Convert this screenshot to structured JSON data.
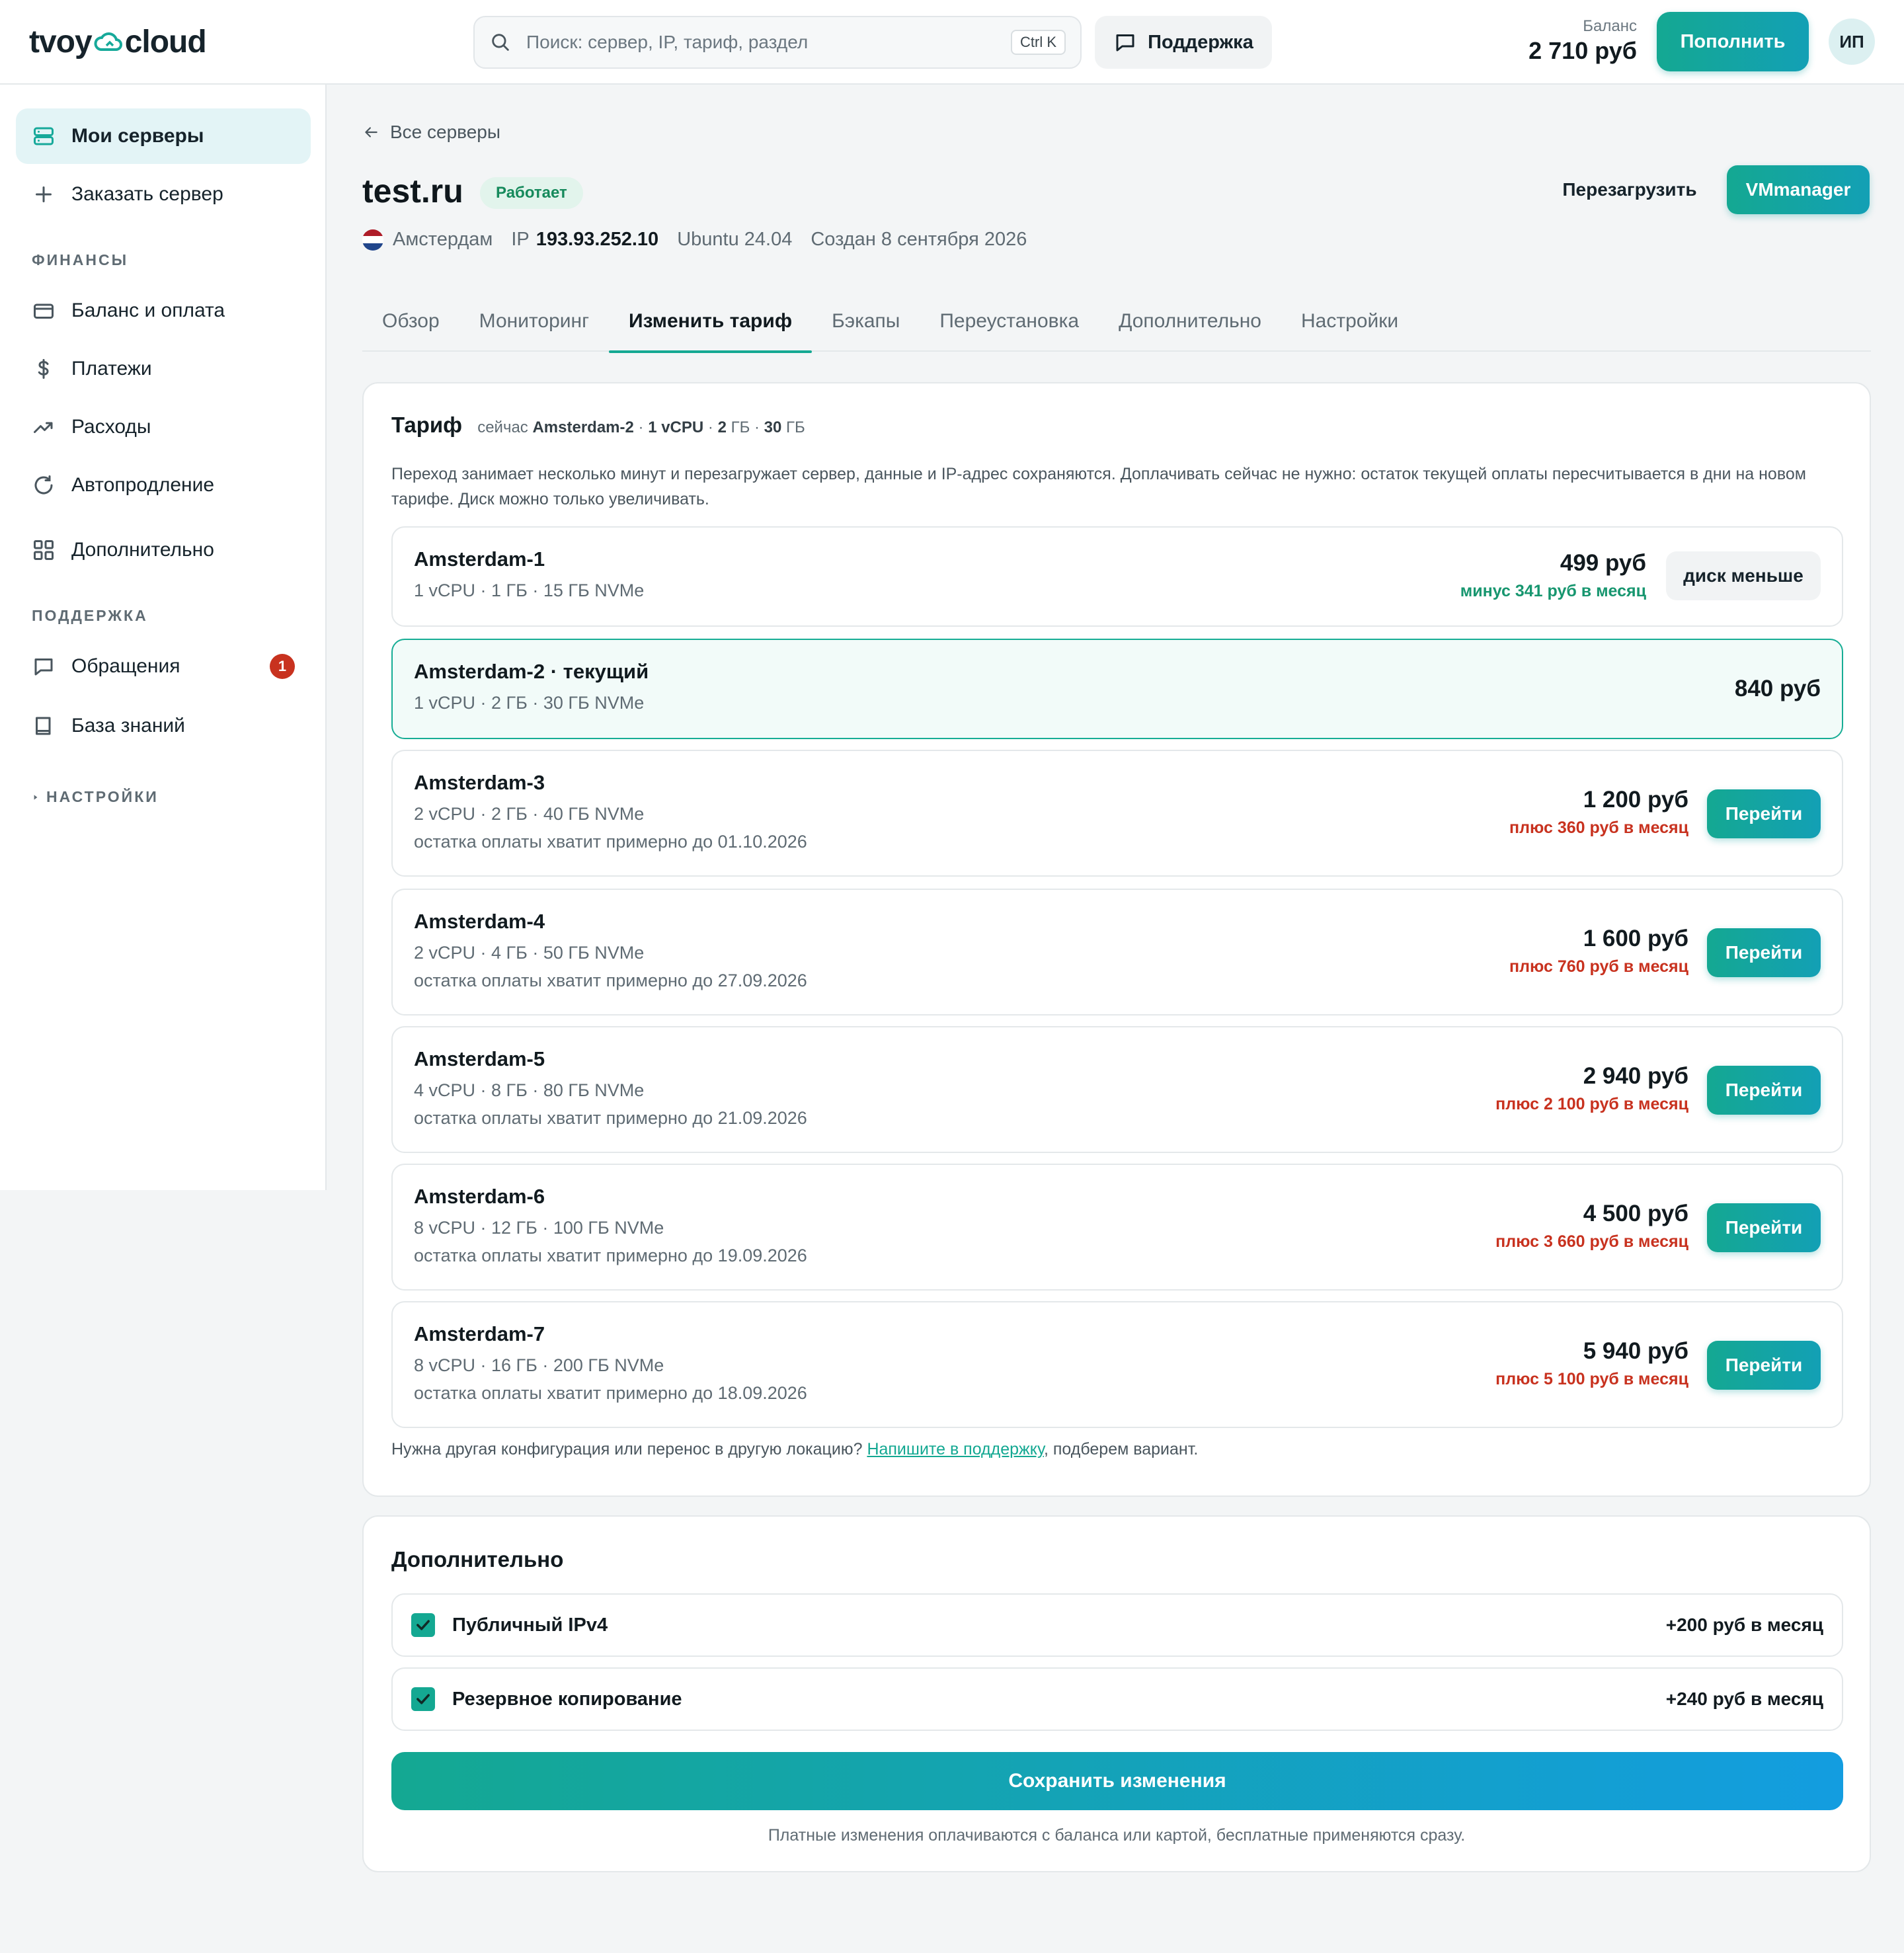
{
  "header": {
    "logo_left": "tvoy",
    "logo_right": "cloud",
    "search_placeholder": "Поиск: сервер, IP, тариф, раздел",
    "search_kbd": "Ctrl K",
    "support": "Поддержка",
    "balance_label": "Баланс",
    "balance_value": "2 710 руб",
    "topup": "Пополнить",
    "avatar": "ИП"
  },
  "sidebar": {
    "my_servers": "Мои серверы",
    "order_server": "Заказать сервер",
    "finance_section": "ФИНАНСЫ",
    "balance_pay": "Баланс и оплата",
    "payments": "Платежи",
    "expenses": "Расходы",
    "autorenew": "Автопродление",
    "extra": "Дополнительно",
    "support_section": "ПОДДЕРЖКА",
    "tickets": "Обращения",
    "tickets_badge": "1",
    "knowledge": "База знаний",
    "settings_section": "НАСТРОЙКИ"
  },
  "server": {
    "back": "Все серверы",
    "name": "test.ru",
    "status": "Работает",
    "reboot": "Перезагрузить",
    "vmmanager": "VMmanager",
    "location": "Амстердам",
    "ip_label": "IP",
    "ip": "193.93.252.10",
    "os": "Ubuntu 24.04",
    "created": "Создан 8 сентября 2026"
  },
  "tabs": [
    "Обзор",
    "Мониторинг",
    "Изменить тариф",
    "Бэкапы",
    "Переустановка",
    "Дополнительно",
    "Настройки"
  ],
  "tariff": {
    "title": "Тариф",
    "now_prefix": "сейчас",
    "now_plan": "Amsterdam-2",
    "now_cpu": "1 vCPU",
    "now_ram_num": "2",
    "now_ram_unit": "ГБ",
    "now_disk_num": "30",
    "now_disk_unit": "ГБ",
    "description": "Переход занимает несколько минут и перезагружает сервер, данные и IP-адрес сохраняются. Доплачивать сейчас не нужно: остаток текущей оплаты пересчитывается в дни на новом тарифе. Диск можно только увеличивать.",
    "plans": [
      {
        "name": "Amsterdam-1",
        "spec": "1 vCPU · 1 ГБ · 15 ГБ NVMe",
        "price": "499 руб",
        "diff": "минус 341 руб в месяц",
        "action": "диск меньше"
      },
      {
        "name": "Amsterdam-2 · текущий",
        "spec": "1 vCPU · 2 ГБ · 30 ГБ NVMe",
        "price": "840 руб"
      },
      {
        "name": "Amsterdam-3",
        "spec": "2 vCPU · 2 ГБ · 40 ГБ NVMe",
        "note": "остатка оплаты хватит примерно до 01.10.2026",
        "price": "1 200 руб",
        "diff": "плюс 360 руб в месяц",
        "action": "Перейти"
      },
      {
        "name": "Amsterdam-4",
        "spec": "2 vCPU · 4 ГБ · 50 ГБ NVMe",
        "note": "остатка оплаты хватит примерно до 27.09.2026",
        "price": "1 600 руб",
        "diff": "плюс 760 руб в месяц",
        "action": "Перейти"
      },
      {
        "name": "Amsterdam-5",
        "spec": "4 vCPU · 8 ГБ · 80 ГБ NVMe",
        "note": "остатка оплаты хватит примерно до 21.09.2026",
        "price": "2 940 руб",
        "diff": "плюс 2 100 руб в месяц",
        "action": "Перейти"
      },
      {
        "name": "Amsterdam-6",
        "spec": "8 vCPU · 12 ГБ · 100 ГБ NVMe",
        "note": "остатка оплаты хватит примерно до 19.09.2026",
        "price": "4 500 руб",
        "diff": "плюс 3 660 руб в месяц",
        "action": "Перейти"
      },
      {
        "name": "Amsterdam-7",
        "spec": "8 vCPU · 16 ГБ · 200 ГБ NVMe",
        "note": "остатка оплаты хватит примерно до 18.09.2026",
        "price": "5 940 руб",
        "diff": "плюс 5 100 руб в месяц",
        "action": "Перейти"
      }
    ],
    "footer_text": "Нужна другая конфигурация или перенос в другую локацию?",
    "footer_link": "Напишите в поддержку",
    "footer_tail": ", подберем вариант."
  },
  "extras": {
    "title": "Дополнительно",
    "options": [
      {
        "label": "Публичный IPv4",
        "price": "+200 руб в месяц",
        "checked": true
      },
      {
        "label": "Резервное копирование",
        "price": "+240 руб в месяц",
        "checked": true
      }
    ],
    "save": "Сохранить изменения",
    "note": "Платные изменения оплачиваются с баланса или картой, бесплатные применяются сразу."
  },
  "colors": {
    "accent": "#14a892",
    "plus": "#c8321f",
    "minus": "#17966f",
    "badge": "#c8321f"
  }
}
